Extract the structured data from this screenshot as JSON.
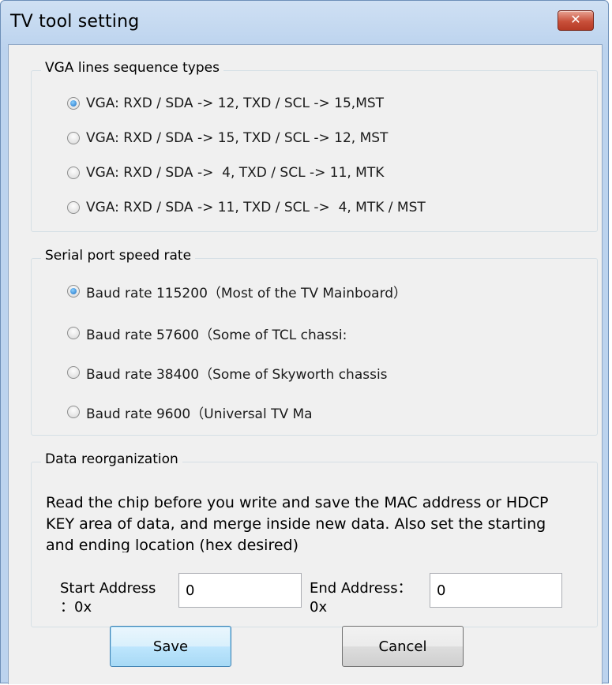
{
  "window": {
    "title": "TV tool setting",
    "close_label": "✕"
  },
  "vga_group": {
    "legend": "VGA lines sequence types",
    "options": [
      {
        "label": "VGA: RXD / SDA -> 12, TXD / SCL -> 15,MST",
        "selected": true
      },
      {
        "label": "VGA: RXD / SDA -> 15, TXD / SCL -> 12, MST",
        "selected": false
      },
      {
        "label": "VGA: RXD / SDA ->  4, TXD / SCL -> 11, MTK",
        "selected": false
      },
      {
        "label": "VGA: RXD / SDA -> 11, TXD / SCL ->  4, MTK / MST",
        "selected": false
      }
    ]
  },
  "serial_group": {
    "legend": "Serial port speed rate",
    "options": [
      {
        "label": "Baud rate 115200（Most of the TV Mainboard）",
        "selected": true
      },
      {
        "label": "Baud rate 57600（Some of TCL chassi:",
        "selected": false
      },
      {
        "label": "Baud rate 38400（Some of Skyworth chassis",
        "selected": false
      },
      {
        "label": "Baud rate 9600（Universal TV Ma",
        "selected": false
      }
    ]
  },
  "data_group": {
    "legend": "Data reorganization",
    "description": "Read the chip before you write and save the MAC address or HDCP KEY area of data, and merge inside new data. Also set the starting and ending location (hex desired)",
    "start_label": "Start Address\n：0x",
    "start_value": "0",
    "end_label": "End Address：\n0x",
    "end_value": "0"
  },
  "buttons": {
    "save": "Save",
    "cancel": "Cancel"
  },
  "colors": {
    "title_bar": "#bcd3ee",
    "close_button": "#c8503a",
    "dialog_bg": "#f0f0f0",
    "default_button_border": "#3c7fb1"
  }
}
